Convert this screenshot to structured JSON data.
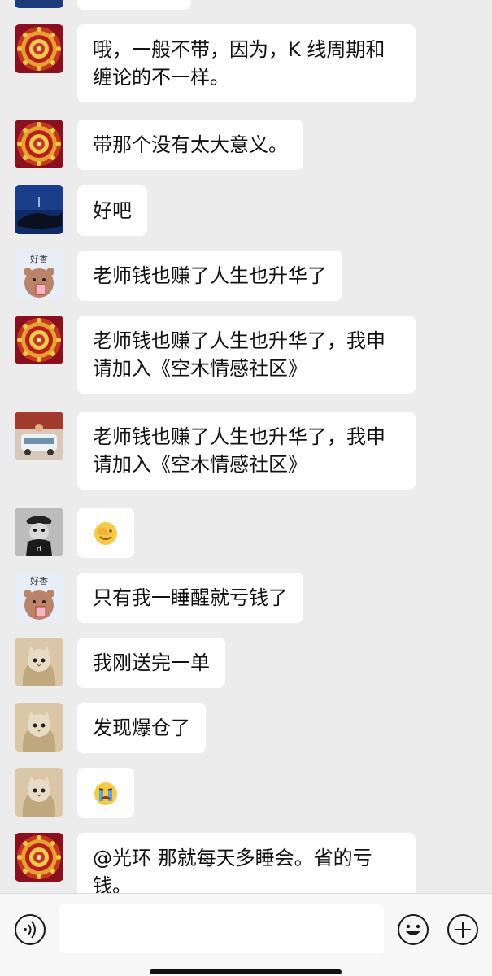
{
  "colors": {
    "chat_background": "#ececec",
    "bubble": "#ffffff",
    "text": "#111111",
    "input_bar": "#f7f7f7"
  },
  "messages": [
    {
      "avatar": "mandala-avatar",
      "text": "哦，一般不带，因为，K 线周期和缠论的不一样。"
    },
    {
      "avatar": "mandala-avatar",
      "text": "带那个没有太大意义。"
    },
    {
      "avatar": "whale-night-avatar",
      "text": "好吧"
    },
    {
      "avatar": "bear-sticker-avatar",
      "text": "老师钱也赚了人生也升华了"
    },
    {
      "avatar": "mandala-avatar",
      "text": "老师钱也赚了人生也升华了，我申请加入《空木情感社区》"
    },
    {
      "avatar": "car-photo-avatar",
      "text": "老师钱也赚了人生也升华了，我申请加入《空木情感社区》"
    },
    {
      "avatar": "dog-cap-avatar",
      "text": "",
      "emoji": "facepalm-emoji"
    },
    {
      "avatar": "bear-sticker-avatar",
      "text": "只有我一睡醒就亏钱了"
    },
    {
      "avatar": "cat-avatar",
      "text": "我刚送完一单"
    },
    {
      "avatar": "cat-avatar",
      "text": "发现爆仓了"
    },
    {
      "avatar": "cat-avatar",
      "text": "",
      "emoji": "loudly-crying-emoji"
    },
    {
      "avatar": "mandala-avatar",
      "text": "@光环  那就每天多睡会。省的亏钱。"
    }
  ],
  "input_bar": {
    "voice_icon": "voice-icon",
    "placeholder": "",
    "emoji_icon": "smiley-icon",
    "plus_icon": "plus-icon"
  }
}
